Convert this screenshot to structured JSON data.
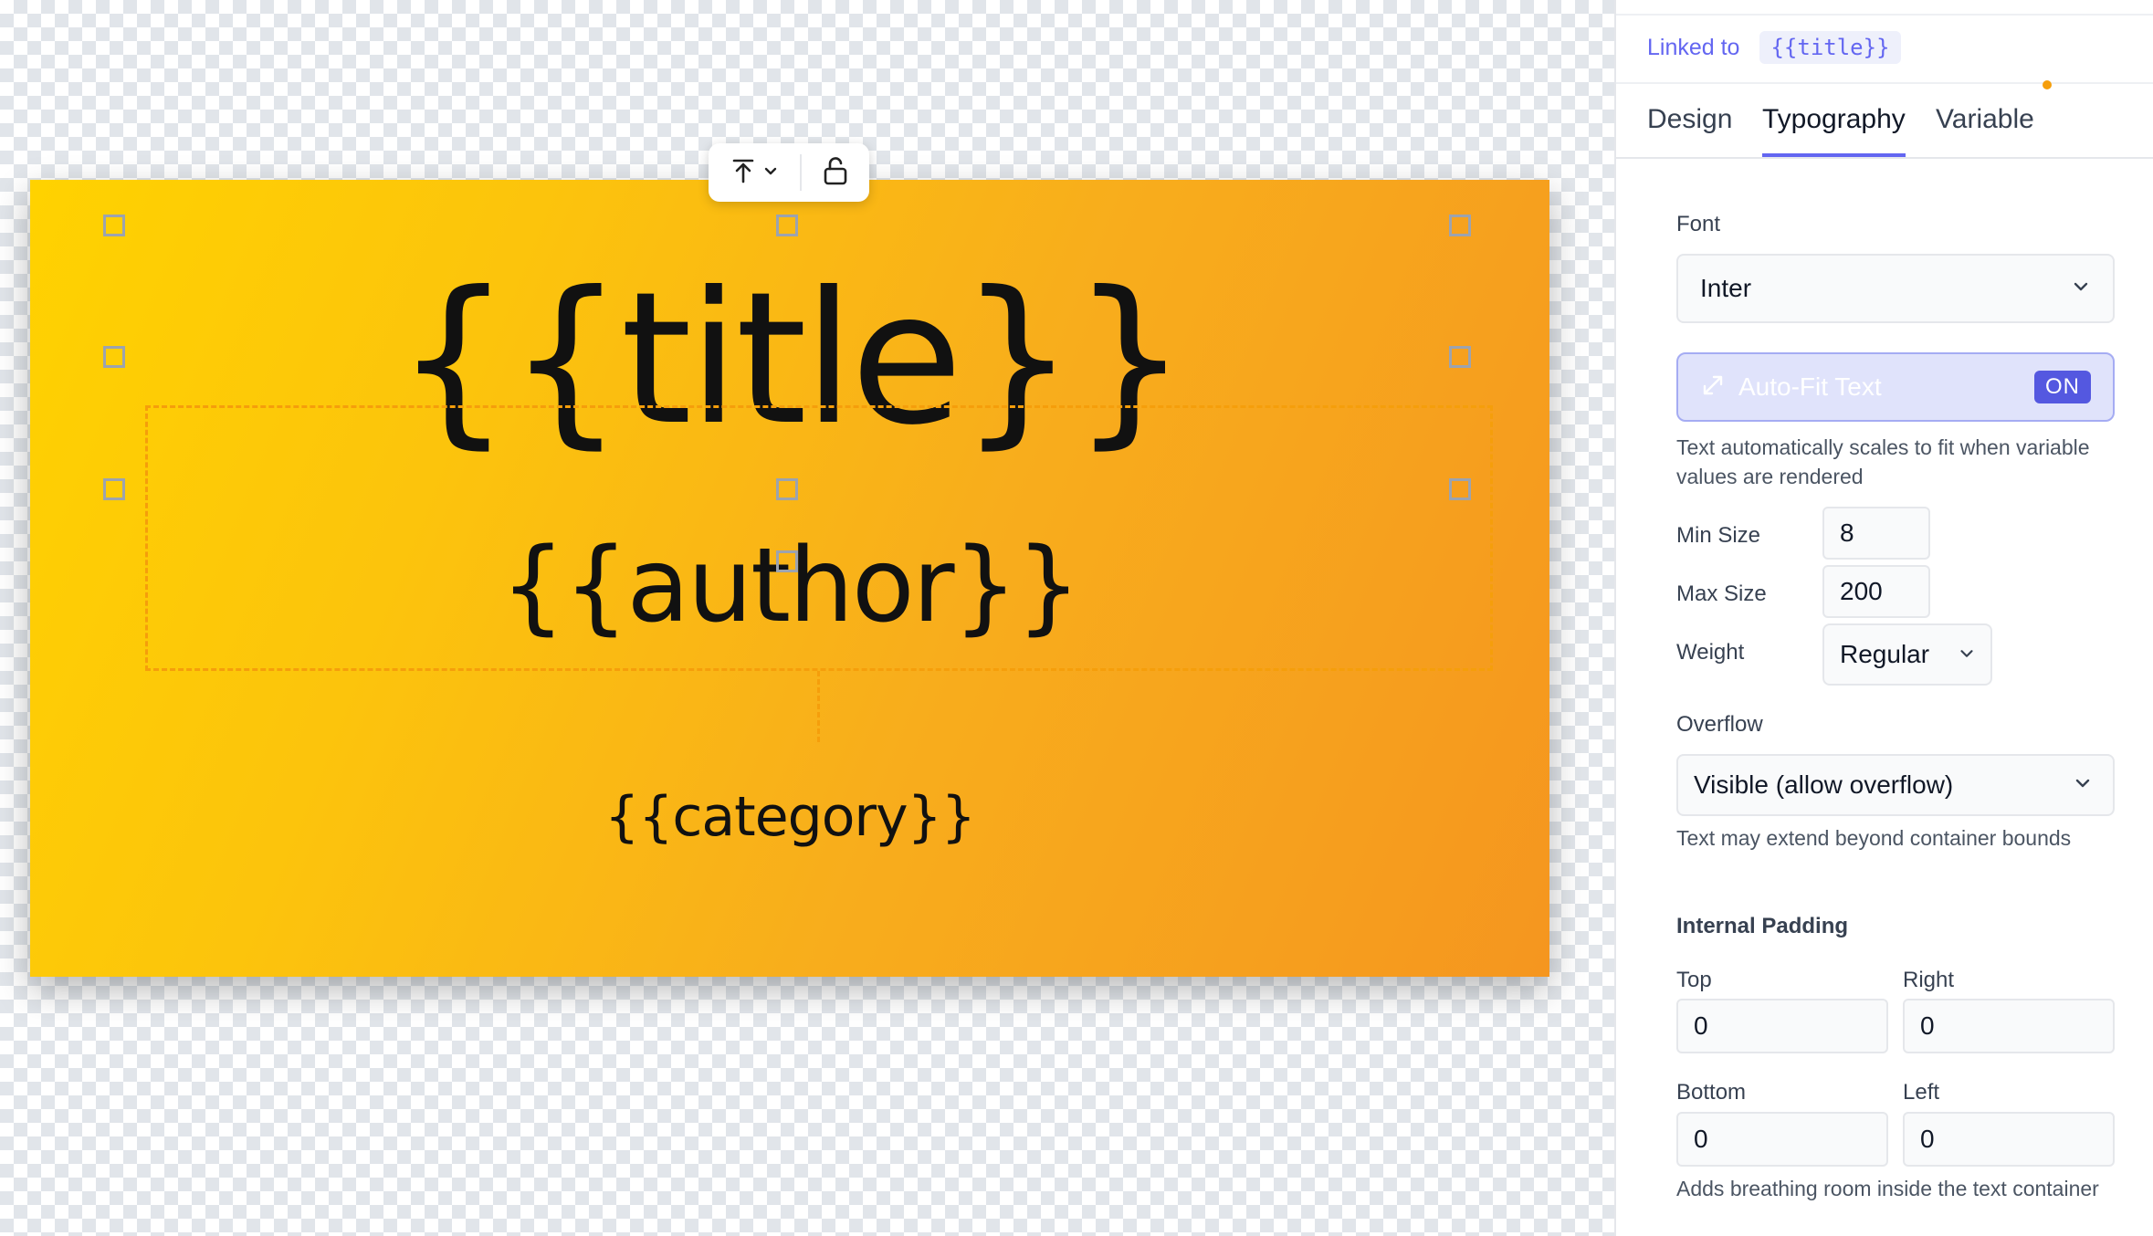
{
  "canvas": {
    "title_text": "{{title}}",
    "author_text": "{{author}}",
    "category_text": "{{category}}",
    "toolbar": {
      "align_icon": "align-top-icon",
      "dropdown_icon": "chevron-down-icon",
      "lock_icon": "unlock-icon"
    }
  },
  "panel": {
    "linked_label": "Linked to",
    "linked_variable": "{{title}}",
    "tabs": [
      {
        "label": "Design",
        "active": false
      },
      {
        "label": "Typography",
        "active": true
      },
      {
        "label": "Variable",
        "active": false
      }
    ],
    "font": {
      "label": "Font",
      "value": "Inter"
    },
    "autofit": {
      "icon": "expand-icon",
      "label": "Auto-Fit Text",
      "state": "ON",
      "help": "Text automatically scales to fit when variable values are rendered"
    },
    "min_size": {
      "label": "Min Size",
      "value": "8"
    },
    "max_size": {
      "label": "Max Size",
      "value": "200"
    },
    "weight": {
      "label": "Weight",
      "value": "Regular"
    },
    "overflow": {
      "label": "Overflow",
      "value": "Visible (allow overflow)",
      "help": "Text may extend beyond container bounds"
    },
    "padding": {
      "heading": "Internal Padding",
      "top": {
        "label": "Top",
        "value": "0"
      },
      "right": {
        "label": "Right",
        "value": "0"
      },
      "bottom": {
        "label": "Bottom",
        "value": "0"
      },
      "left": {
        "label": "Left",
        "value": "0"
      },
      "help": "Adds breathing room inside the text container"
    }
  },
  "colors": {
    "accent": "#6366f1",
    "selection": "#f59e0b",
    "gradient_start": "#ffd200",
    "gradient_end": "#f5961f"
  }
}
